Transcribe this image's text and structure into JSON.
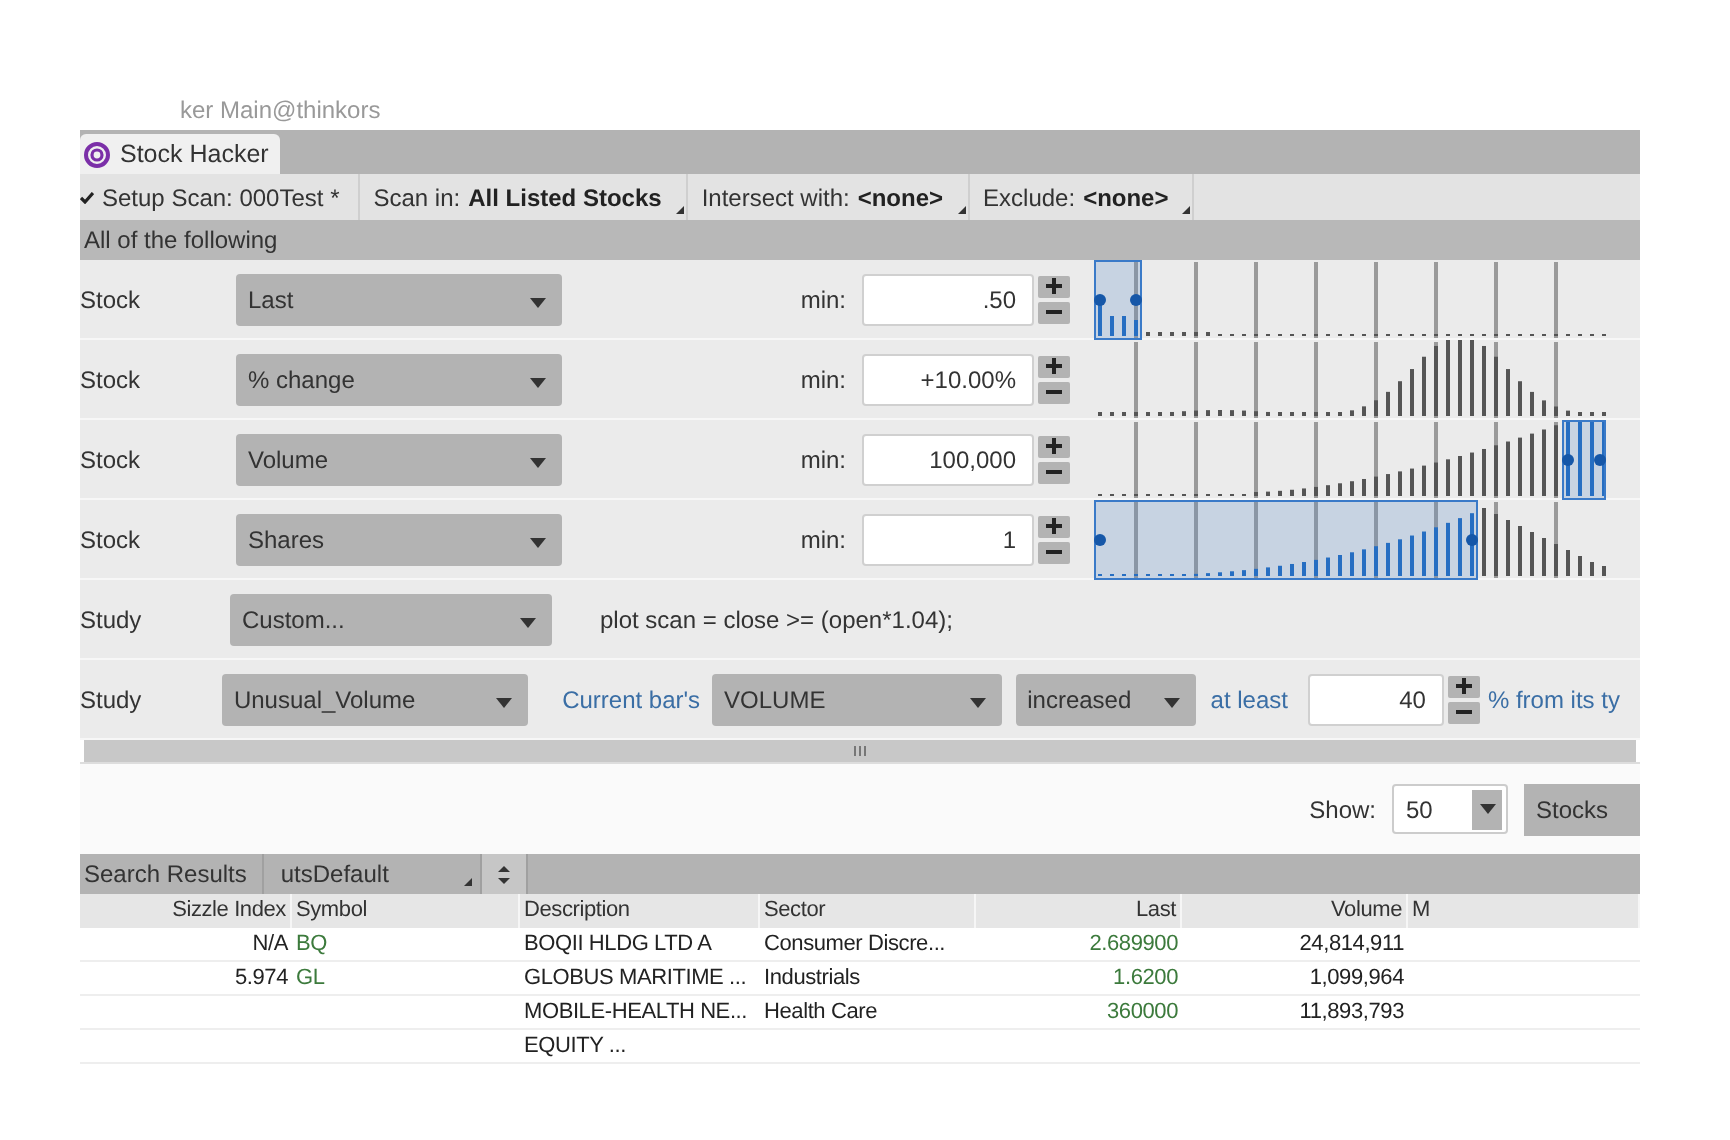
{
  "window": {
    "title": "ker Main@thinkors"
  },
  "tabs": [
    {
      "label": "Stock Hacker",
      "selected": true
    }
  ],
  "toolbar": {
    "setup": "Setup Scan: 000Test *",
    "scan_in_label": "Scan in:",
    "scan_in": "All Listed Stocks",
    "intersect_label": "Intersect with:",
    "intersect": "<none>",
    "exclude_label": "Exclude:",
    "exclude": "<none>"
  },
  "group_header": "All of the following",
  "filters": [
    {
      "kind": "stock",
      "type": "Stock",
      "field": "Last",
      "min_label": "min:",
      "value": ".50"
    },
    {
      "kind": "stock",
      "type": "Stock",
      "field": "% change",
      "min_label": "min:",
      "value": "+10.00%"
    },
    {
      "kind": "stock",
      "type": "Stock",
      "field": "Volume",
      "min_label": "min:",
      "value": "100,000"
    },
    {
      "kind": "stock",
      "type": "Stock",
      "field": "Shares",
      "min_label": "min:",
      "value": "1"
    },
    {
      "kind": "custom",
      "type": "Study",
      "field": "Custom...",
      "script": "plot scan = close >= (open*1.04);"
    },
    {
      "kind": "unusual",
      "type": "Study",
      "field": "Unusual_Volume",
      "prefix": "Current bar's",
      "source": "VOLUME",
      "direction": "increased",
      "at_least": "at least",
      "value": "40",
      "suffix": "% from its ty"
    }
  ],
  "show": {
    "label": "Show:",
    "value": "50",
    "type": "Stocks"
  },
  "results": {
    "label": "Search Results",
    "watchlist": "utsDefault",
    "columns": [
      "Sizzle Index",
      "Symbol",
      "Description",
      "Sector",
      "Last",
      "Volume",
      "M"
    ],
    "rows": [
      {
        "sizzle": "N/A",
        "symbol": "BQ",
        "description": "BOQII HLDG LTD A",
        "sector": "Consumer Discre...",
        "last": "2.689900",
        "volume": "24,814,911"
      },
      {
        "sizzle": "5.974",
        "symbol": "GL",
        "description": "GLOBUS MARITIME ...",
        "sector": "Industrials",
        "last": "1.6200",
        "volume": "1,099,964"
      },
      {
        "description": "MOBILE-HEALTH NE...",
        "sector": "Health Care",
        "last": "360000",
        "volume": "11,893,793"
      },
      {
        "description": "EQUITY ..."
      }
    ]
  }
}
